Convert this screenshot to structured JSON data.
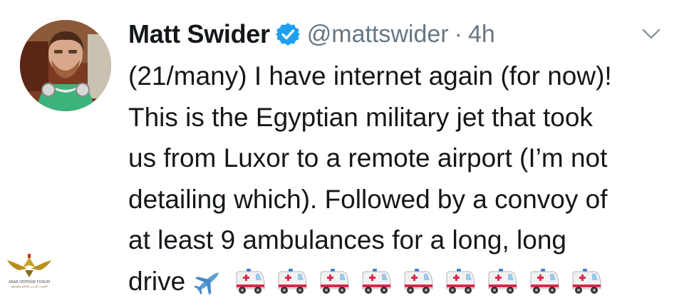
{
  "tweet": {
    "author_name": "Matt Swider",
    "handle": "@mattswider",
    "separator": "·",
    "time": "4h",
    "lines": [
      "(21/many) I have internet again (for now)!",
      "This is the Egyptian military jet that took",
      "us from Luxor to a remote airport (I’m not",
      "detailing which). Followed by a convoy of",
      "at least 9 ambulances for a long, long",
      "drive"
    ],
    "emojis": [
      "airplane-icon",
      "ambulance-icon",
      "ambulance-icon",
      "ambulance-icon",
      "ambulance-icon",
      "ambulance-icon",
      "ambulance-icon",
      "ambulance-icon",
      "ambulance-icon",
      "ambulance-icon"
    ]
  },
  "watermark": {
    "label": "ARAB DEFENSE FORUM",
    "sublabel": "المنتدى العربي للدفاع والتسليح"
  },
  "colors": {
    "verified_blue": "#1da1f2",
    "text": "#14171a",
    "secondary": "#657786",
    "ambulance_red": "#e0264b"
  }
}
